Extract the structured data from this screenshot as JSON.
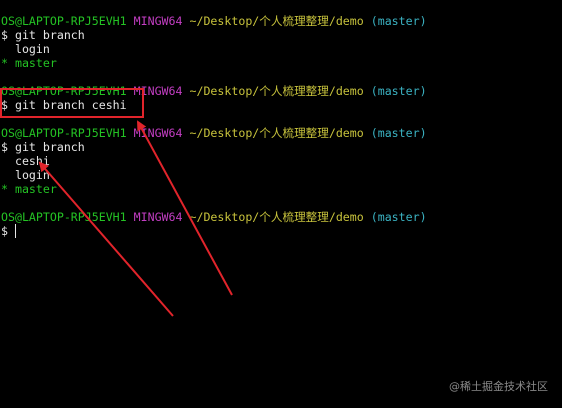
{
  "prompt": {
    "user": "OS@LAPTOP-RPJ5EVH1",
    "env": "MINGW64",
    "path": "~/Desktop/个人梳理整理/demo",
    "branch": "(master)"
  },
  "blocks": [
    {
      "command": "$ git branch",
      "output": [
        {
          "text": "  login",
          "current": false
        },
        {
          "text": "* master",
          "current": true
        }
      ]
    },
    {
      "command": "$ git branch ceshi",
      "output": []
    },
    {
      "command": "$ git branch",
      "output": [
        {
          "text": "  ceshi",
          "current": false
        },
        {
          "text": "  login",
          "current": false
        },
        {
          "text": "* master",
          "current": true
        }
      ]
    }
  ],
  "final_prompt_symbol": "$",
  "watermark": "@稀土掘金技术社区",
  "colors": {
    "background": "#000000",
    "text": "#e6e6e6",
    "user": "#24c224",
    "env": "#c33ec3",
    "path": "#c8c33c",
    "branch": "#3bb3c3",
    "current_branch": "#24c224",
    "annotation": "#e1242b",
    "watermark": "#8a8a8a"
  }
}
